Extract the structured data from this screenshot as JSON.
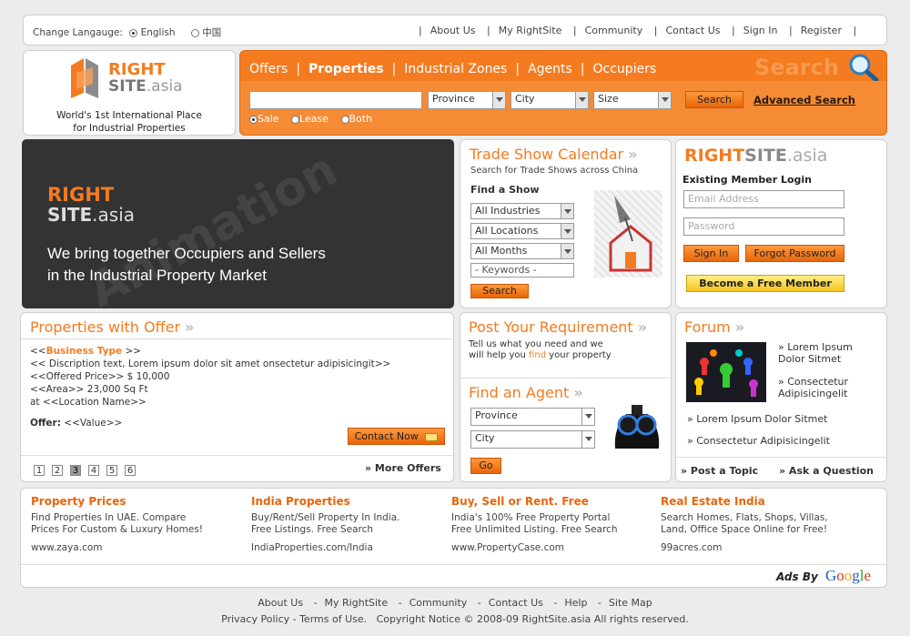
{
  "language": {
    "label": "Change Langauge:",
    "options": [
      "English",
      "中国"
    ],
    "selected": "English"
  },
  "topnav": [
    "About Us",
    "My RightSite",
    "Community",
    "Contact Us",
    "Sign In",
    "Register"
  ],
  "logo": {
    "text_right": "RIGHT",
    "text_site": "SITE",
    "text_asia": ".asia",
    "tagline_1": "World's 1st International Place",
    "tagline_2": "for Industrial Properties"
  },
  "mainnav": [
    "Offers",
    "Properties",
    "Industrial Zones",
    "Agents",
    "Occupiers"
  ],
  "search": {
    "watermark": "Search",
    "query_value": "",
    "province": "Province",
    "city": "City",
    "size": "Size",
    "button": "Search",
    "advanced": "Advanced Search",
    "modes": [
      "Sale",
      "Lease",
      "Both"
    ],
    "selected_mode": "Sale"
  },
  "hero": {
    "right": "RIGHT",
    "site": "SITE",
    "asia": ".asia",
    "line1": "We bring together Occupiers and Sellers",
    "line2": "in the Industrial Property Market",
    "watermark": "Animation"
  },
  "tradeshow": {
    "title": "Trade Show Calendar",
    "subtitle": "Search for Trade Shows across China",
    "find": "Find a Show",
    "industries": "All Industries",
    "locations": "All Locations",
    "months": "All Months",
    "keywords": "- Keywords -",
    "button": "Search"
  },
  "login": {
    "brand_right": "RIGHT",
    "brand_site": "SITE",
    "brand_asia": ".asia",
    "heading": "Existing Member Login",
    "email_placeholder": "Email Address",
    "password_placeholder": "Password",
    "signin": "Sign In",
    "forgot": "Forgot Password",
    "become": "Become a Free Member"
  },
  "offers": {
    "title": "Properties with Offer",
    "type_label": "Business Type",
    "line_open": "<<",
    "line_close": ">>",
    "desc": "<< Discription text, Lorem ipsum dolor sit amet onsectetur adipisicingit>>",
    "price": "<<Offered Price>> $ 10,000",
    "area": "<<Area>> 23,000 Sq Ft",
    "location": "at <<Location Name>>",
    "offer_label": "Offer:",
    "offer_value": "<<Value>>",
    "contact": "Contact Now",
    "pages": [
      "1",
      "2",
      "3",
      "4",
      "5",
      "6"
    ],
    "current_page": "3",
    "more": "» More Offers"
  },
  "requirement": {
    "title": "Post Your Requirement",
    "line1": "Tell us what you need and we",
    "line2_a": "will help you",
    "line2_find": "find",
    "line2_b": "your property"
  },
  "agent": {
    "title": "Find an Agent",
    "province": "Province",
    "city": "City",
    "button": "Go"
  },
  "forum": {
    "title": "Forum",
    "items": [
      "» Lorem Ipsum Dolor Sitmet",
      "» Consectetur Adipisicingelit",
      "» Lorem Ipsum Dolor Sitmet",
      "» Consectetur Adipisicingelit"
    ],
    "post": "» Post a Topic",
    "ask": "» Ask a Question"
  },
  "ads": [
    {
      "title": "Property Prices",
      "l1": "Find Properties In UAE. Compare",
      "l2": "Prices For Custom & Luxury Homes!",
      "url": "www.zaya.com"
    },
    {
      "title": "India Properties",
      "l1": "Buy/Rent/Sell Property In India.",
      "l2": "Free Listings. Free Search",
      "url": "IndiaProperties.com/India"
    },
    {
      "title": "Buy, Sell or Rent. Free",
      "l1": "India's 100% Free Property Portal",
      "l2": "Free Unlimited Listing. Free Search",
      "url": "www.PropertyCase.com"
    },
    {
      "title": "Real Estate India",
      "l1": "Search Homes, Flats, Shops, Villas,",
      "l2": "Land, Office Space Online for Free!",
      "url": "99acres.com"
    }
  ],
  "ads_by": "Ads By",
  "google": [
    "G",
    "o",
    "o",
    "g",
    "l",
    "e"
  ],
  "footer": {
    "links": [
      "About Us",
      "My RightSite",
      "Community",
      "Contact Us",
      "Help",
      "Site Map"
    ],
    "line2": "Privacy Policy - Terms of Use.   Copyright Notice © 2008-09 RightSite.asia All rights reserved."
  },
  "colors": {
    "accent": "#f47b20",
    "nav_bg": "#f47b20",
    "hero_bg": "#333333"
  }
}
